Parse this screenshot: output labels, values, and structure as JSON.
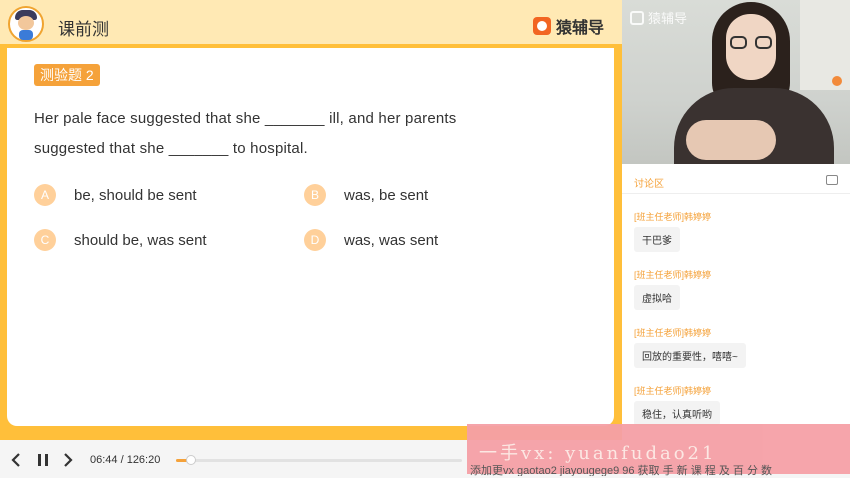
{
  "header": {
    "title": "课前测",
    "brand": "猿辅导"
  },
  "question": {
    "badge": "测验题 2",
    "line1": "Her pale face suggested that she _______ ill, and her parents",
    "line2": "suggested that she _______ to hospital.",
    "options": [
      {
        "letter": "A",
        "text": "be, should be sent"
      },
      {
        "letter": "B",
        "text": "was, be sent"
      },
      {
        "letter": "C",
        "text": "should be, was sent"
      },
      {
        "letter": "D",
        "text": "was, was sent"
      }
    ]
  },
  "video": {
    "logo_text": "猿辅导"
  },
  "chat": {
    "tab_label": "讨论区",
    "messages": [
      {
        "sender": "[班主任老师]韩婷婷",
        "text": "干巴爹"
      },
      {
        "sender": "[班主任老师]韩婷婷",
        "text": "虚拟哈"
      },
      {
        "sender": "[班主任老师]韩婷婷",
        "text": "回放的重要性，嘻嘻~"
      },
      {
        "sender": "[班主任老师]韩婷婷",
        "text": "稳住，认真听哟"
      }
    ]
  },
  "player": {
    "prev_icon": "chevron-left-icon",
    "pause_icon": "pause-icon",
    "next_icon": "chevron-right-icon",
    "time": "06:44 / 126:20",
    "progress": 0.053
  },
  "watermark": {
    "text": "一手vx: yuanfudao21",
    "strip_text": "添加更vx gaotao2 jiayougege9 96 获取 手 新 课 程 及 百 分 数"
  },
  "colors": {
    "accent": "#f5a23a",
    "frame": "#ffbf3a",
    "header_bg": "#ffe9b4",
    "option_circle": "#ffd09a",
    "brand_orange": "#f26522"
  }
}
